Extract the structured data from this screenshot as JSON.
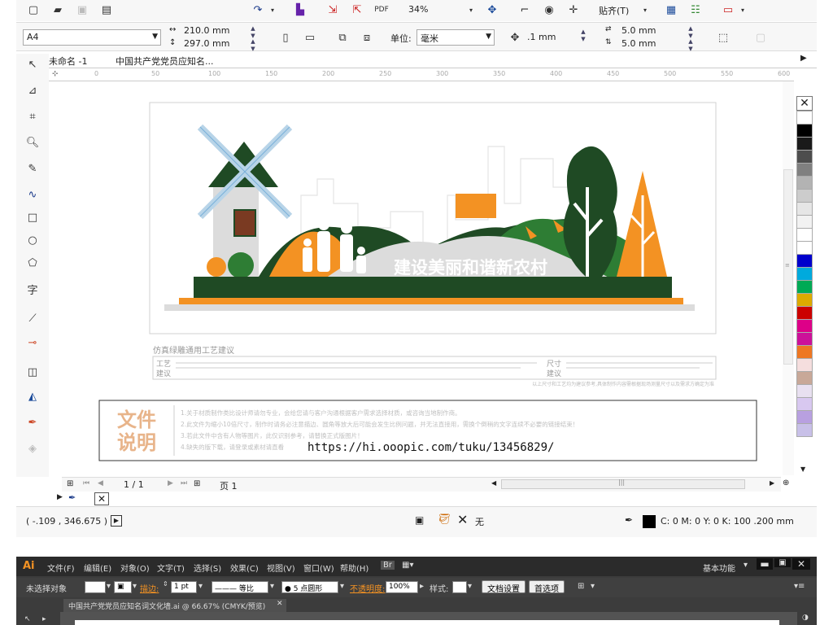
{
  "toolbar": {
    "zoom": "34%",
    "snap_label": "贴齐(T)"
  },
  "propbar": {
    "page_size": "A4",
    "width": "210.0 mm",
    "height": "297.0 mm",
    "unit_label": "单位:",
    "unit_value": "毫米",
    "nudge": ".1 mm",
    "dup_x": "5.0 mm",
    "dup_y": "5.0 mm"
  },
  "tabs": [
    {
      "label": "未命名 -1"
    },
    {
      "label": "中国共产党党员应知名..."
    }
  ],
  "ruler_ticks": [
    "0",
    "50",
    "100",
    "150",
    "200",
    "250",
    "300",
    "350",
    "400",
    "450",
    "500",
    "550",
    "600"
  ],
  "artwork": {
    "slogan": "建设美丽和谐新农村",
    "spec_title": "仿真绿雕通用工艺建议",
    "spec_left_label1": "工艺",
    "spec_left_label2": "建议",
    "spec_right_label1": "尺寸",
    "spec_right_label2": "建议",
    "spec_note": "以上尺寸和工艺均为建议参考,具体制作内容需根据现场测量尺寸以及需求方确定为准"
  },
  "doc_note": {
    "heading1": "文件",
    "heading2": "说明",
    "lines": [
      "1.关于材质制作类比设计师请勿专业，会给您请与客户沟通根据客户需求选择材质，或咨询当地制作商。",
      "2.此文件为缩小10倍尺寸，制作时请务必注意描边、圆角等放大后可能会发生比例问题，并无法直接用，需换个倒稍的文字连续不必要的链接结束！",
      "3.若此文件中含有人物等图片，此仅识别参考，请替换正式版图片！",
      "4.缺失的版下载，请登录或素材请直看"
    ],
    "url": "https://hi.ooopic.com/tuku/13456829/"
  },
  "pager": {
    "page_count": "1 / 1",
    "page_tab": "页 1"
  },
  "status": {
    "coords": "( -.109 , 346.675 )",
    "fill_none": "无",
    "outline": "C: 0 M: 0 Y: 0 K: 100  .200 mm"
  },
  "palette": [
    "#ffffff",
    "#000000",
    "#1a1a1a",
    "#4d4d4d",
    "#808080",
    "#b3b3b3",
    "#cccccc",
    "#e6e6e6",
    "#f2f2f2",
    "#ffffff",
    "#ffffff",
    "#0000cc",
    "#00aadd",
    "#00aa55",
    "#ddaa00",
    "#cc0000",
    "#dd0088",
    "#cc1199",
    "#ee7722",
    "#f5dede",
    "#c8a898",
    "#e8e0f0",
    "#d8c8f0",
    "#b8a0e0",
    "#c8c0e8"
  ],
  "ai": {
    "menus": [
      "文件(F)",
      "编辑(E)",
      "对象(O)",
      "文字(T)",
      "选择(S)",
      "效果(C)",
      "视图(V)",
      "窗口(W)",
      "帮助(H)"
    ],
    "workspace": "基本功能",
    "no_selection": "未选择对象",
    "stroke_label": "描边:",
    "stroke_value": "1 pt",
    "stroke_style": "等比",
    "brush": "5 点圆形",
    "opacity_label": "不透明度:",
    "opacity_value": "100%",
    "style_label": "样式:",
    "doc_settings": "文档设置",
    "prefs": "首选项",
    "tab_title": "中国共产党党员应知名词文化墙.ai @ 66.67% (CMYK/预览)"
  },
  "colors": {
    "dark_green": "#1f4a24",
    "green": "#2e7d34",
    "orange": "#f39223",
    "grey": "#dcdcdc",
    "note_orange": "#e8b48a"
  }
}
